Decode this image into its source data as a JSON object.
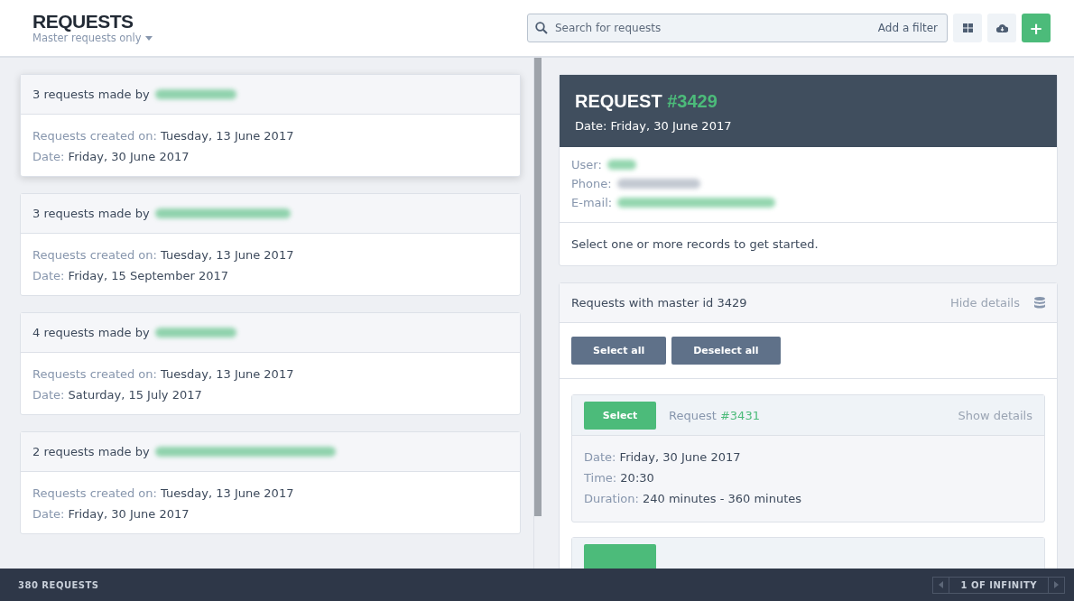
{
  "header": {
    "title": "REQUESTS",
    "filter_label": "Master requests only",
    "search": {
      "placeholder": "Search for requests",
      "filter_link": "Add a filter"
    },
    "add_button": "+"
  },
  "groups": [
    {
      "summary_prefix": "3 requests made by",
      "created_label": "Requests created on:",
      "created_value": "Tuesday, 13 June 2017",
      "date_label": "Date:",
      "date_value": "Friday, 30 June 2017",
      "selected": true
    },
    {
      "summary_prefix": "3 requests made by",
      "created_label": "Requests created on:",
      "created_value": "Tuesday, 13 June 2017",
      "date_label": "Date:",
      "date_value": "Friday, 15 September 2017",
      "selected": false
    },
    {
      "summary_prefix": "4 requests made by",
      "created_label": "Requests created on:",
      "created_value": "Tuesday, 13 June 2017",
      "date_label": "Date:",
      "date_value": "Saturday, 15 July 2017",
      "selected": false
    },
    {
      "summary_prefix": "2 requests made by",
      "created_label": "Requests created on:",
      "created_value": "Tuesday, 13 June 2017",
      "date_label": "Date:",
      "date_value": "Friday, 30 June 2017",
      "selected": false
    }
  ],
  "detail": {
    "title_word": "REQUEST",
    "number": "#3429",
    "date": "Date: Friday, 30 June 2017",
    "user_label": "User:",
    "phone_label": "Phone:",
    "email_label": "E-mail:",
    "hint": "Select one or more records to get started."
  },
  "related": {
    "title": "Requests with master id 3429",
    "toggle": "Hide details",
    "select_all": "Select all",
    "deselect_all": "Deselect all",
    "items": [
      {
        "button": "Select",
        "label": "Request",
        "number": "#3431",
        "toggle": "Show details",
        "expanded": true,
        "fields": [
          {
            "label": "Date:",
            "value": "Friday, 30 June 2017"
          },
          {
            "label": "Time:",
            "value": "20:30"
          },
          {
            "label": "Duration:",
            "value": "240 minutes - 360 minutes"
          }
        ]
      },
      {
        "expanded": false
      }
    ]
  },
  "footer": {
    "count": "380 REQUESTS",
    "pager": "1 OF INFINITY"
  }
}
